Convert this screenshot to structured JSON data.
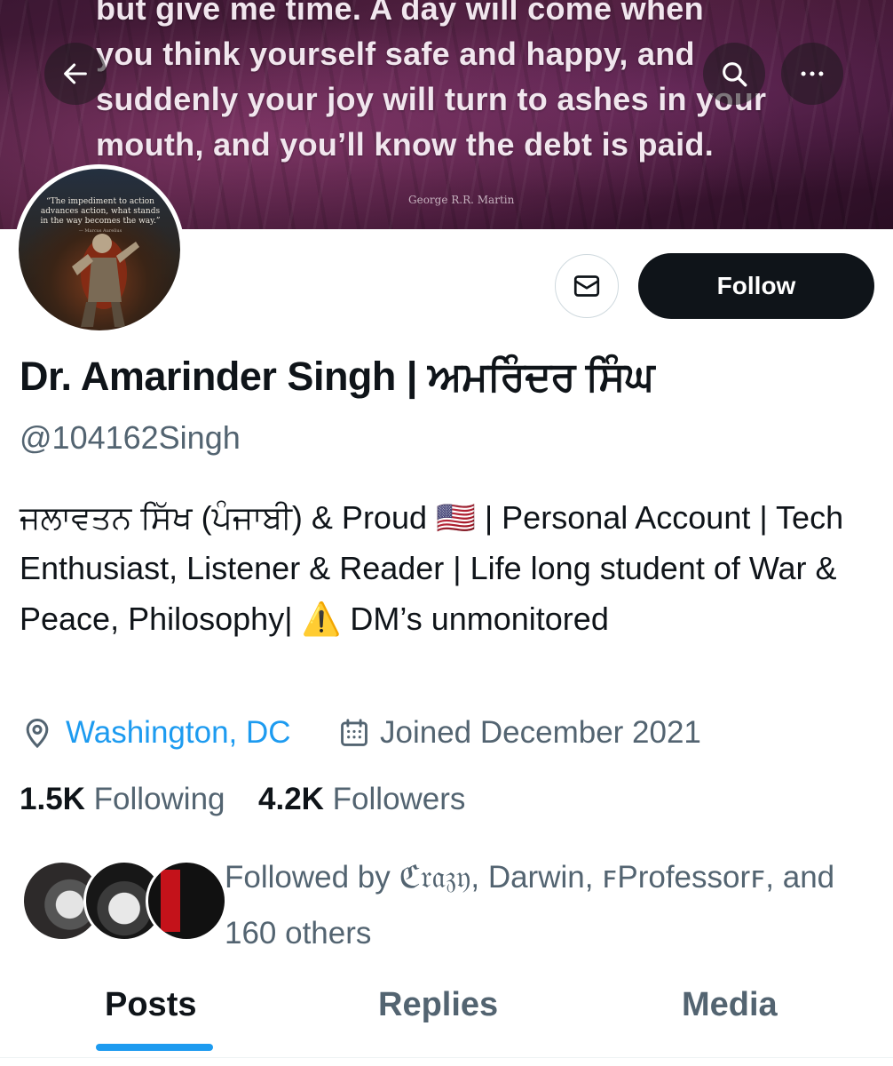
{
  "banner": {
    "quote_lines": [
      "but give me time. A day will come when",
      "you think yourself safe and happy, and",
      "suddenly your joy will turn to ashes in your",
      "mouth, and you’ll know the debt is paid."
    ],
    "quote_author": "George R.R. Martin"
  },
  "nav": {
    "back_icon": "arrow-left-icon",
    "search_icon": "search-icon",
    "more_icon": "more-horizontal-icon"
  },
  "avatar": {
    "quote": "“The impediment to action advances action, what stands in the way becomes the way.”",
    "quote_source": "— Marcus Aurelius"
  },
  "actions": {
    "message_icon": "mail-icon",
    "follow_label": "Follow"
  },
  "profile": {
    "name": "Dr. Amarinder Singh | ਅਮਰਿੰਦਰ ਸਿੰਘ",
    "handle": "@104162Singh",
    "bio": "ਜਲਾਵਤਨ ਸਿੱਖ (ਪੰਜਾਬੀ) & Proud 🇺🇸 | Personal Account | Tech Enthusiast, Listener & Reader | Life long student of War & Peace, Philosophy| ⚠️ DM’s unmonitored",
    "location": "Washington, DC",
    "joined": "Joined December 2021"
  },
  "stats": {
    "following_count": "1.5K",
    "following_label": "Following",
    "followers_count": "4.2K",
    "followers_label": "Followers"
  },
  "followed_by": {
    "text": "Followed by ℭ𝔯𝔞𝔷𝔶, Darwin, ꜰProfessorꜰ, and 160 others"
  },
  "tabs": [
    {
      "label": "Posts",
      "active": true
    },
    {
      "label": "Replies",
      "active": false
    },
    {
      "label": "Media",
      "active": false
    }
  ],
  "colors": {
    "accent": "#1d9bf0",
    "text_primary": "#0f1419",
    "text_secondary": "#536471",
    "follow_bg": "#0f1419"
  }
}
